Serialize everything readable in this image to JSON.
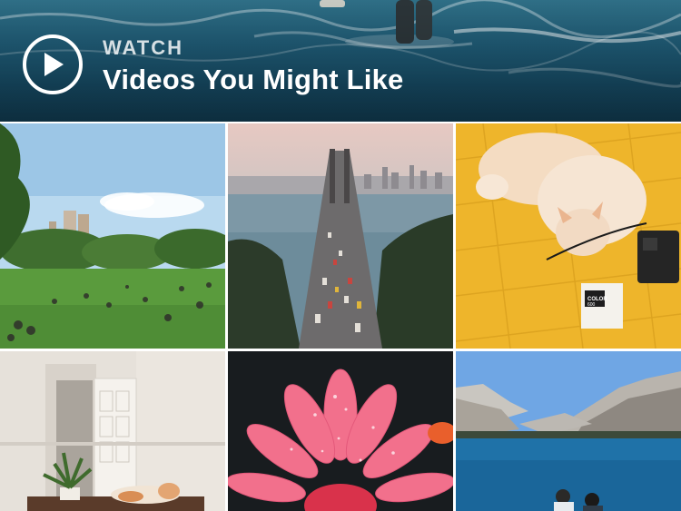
{
  "header": {
    "eyebrow": "WATCH",
    "title": "Videos You Might Like",
    "play_icon": "play-circle-icon"
  },
  "tiles": [
    {
      "subject": "park-lawn-with-skyline"
    },
    {
      "subject": "bay-bridge-traffic"
    },
    {
      "subject": "cat-on-yellow-blanket-with-camera"
    },
    {
      "subject": "white-room-with-plant-and-cat"
    },
    {
      "subject": "pink-gerbera-flower-with-dew"
    },
    {
      "subject": "mountain-lake-with-people"
    }
  ],
  "film_box": {
    "line1": "COLOR",
    "line2": "600"
  }
}
